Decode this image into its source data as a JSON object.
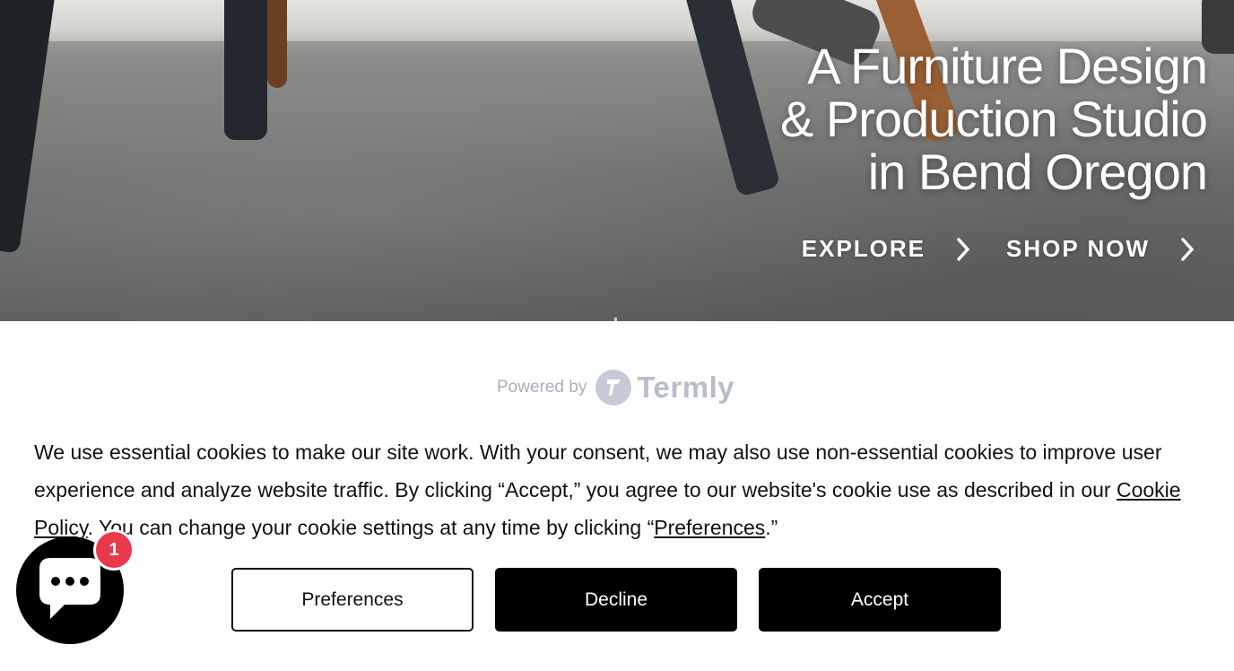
{
  "hero": {
    "title_lines": [
      "A Furniture Design",
      "& Production Studio",
      "in Bend Oregon"
    ],
    "ctas": [
      {
        "label": "EXPLORE",
        "icon": "chevron-right-icon"
      },
      {
        "label": "SHOP NOW",
        "icon": "chevron-right-icon"
      }
    ]
  },
  "consent": {
    "powered_by_label": "Powered by",
    "brand_name": "Termly",
    "text_part1": "We use essential cookies to make our site work. With your consent, we may also use non-essential cookies to improve user experience and analyze website traffic. By clicking “Accept,” you agree to our website's cookie use as described in our ",
    "cookie_policy_link": "Cookie Policy",
    "text_part2": ". You can change your cookie settings at any time by clicking “",
    "preferences_link": "Preferences",
    "text_part3": ".”",
    "buttons": {
      "preferences": "Preferences",
      "decline": "Decline",
      "accept": "Accept"
    }
  },
  "chat": {
    "icon": "chat-bubble-icon",
    "badge_count": "1"
  },
  "colors": {
    "badge": "#e8394d",
    "button_dark": "#000000",
    "termly_gray": "#b8bdca"
  }
}
